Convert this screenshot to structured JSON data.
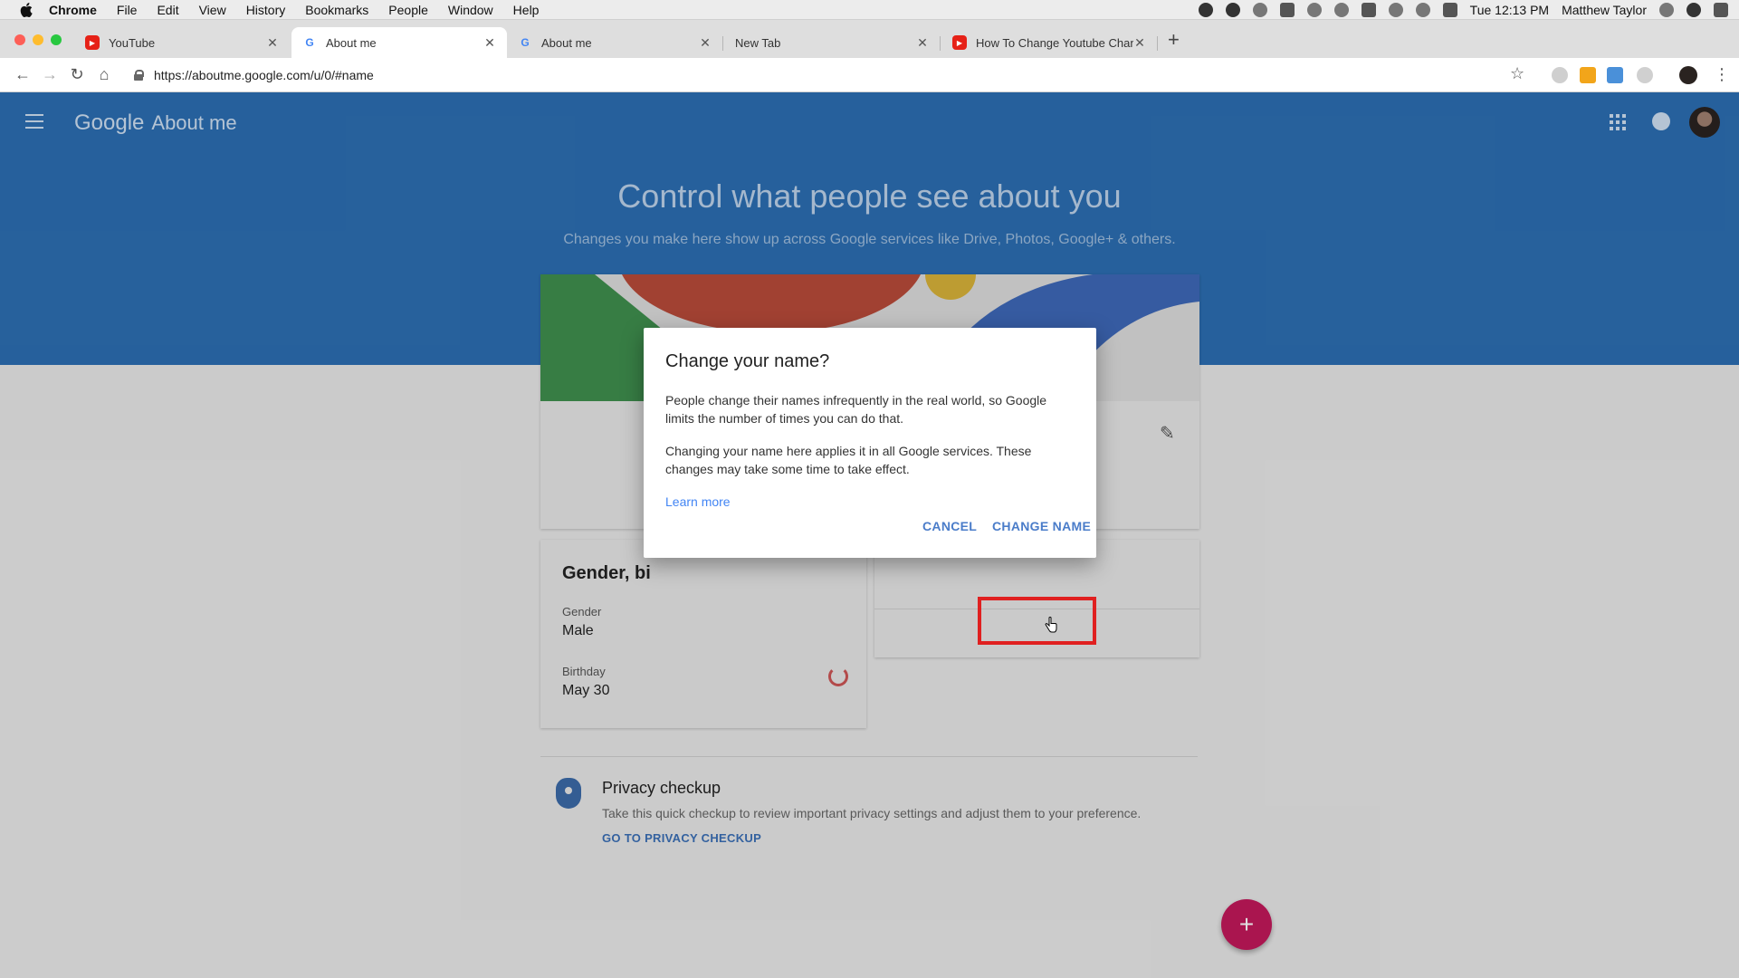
{
  "menubar": {
    "app": "Chrome",
    "items": [
      "File",
      "Edit",
      "View",
      "History",
      "Bookmarks",
      "People",
      "Window",
      "Help"
    ],
    "clock": "Tue 12:13 PM",
    "user": "Matthew Taylor"
  },
  "tabs": [
    {
      "title": "YouTube",
      "icon": "youtube-icon",
      "active": false
    },
    {
      "title": "About me",
      "icon": "google-icon",
      "active": true
    },
    {
      "title": "About me",
      "icon": "google-icon",
      "active": false
    },
    {
      "title": "New Tab",
      "icon": "",
      "active": false
    },
    {
      "title": "How To Change Youtube Chan",
      "icon": "youtube-icon",
      "active": false
    }
  ],
  "toolbar": {
    "url": "https://aboutme.google.com/u/0/#name"
  },
  "page": {
    "brand_google": "Google",
    "brand_product": "About me",
    "hero_title": "Control what people see about you",
    "hero_subtitle": "Changes you make here show up across Google services like Drive, Photos, Google+ & others."
  },
  "gender_card": {
    "heading": "Gender, bi",
    "gender_label": "Gender",
    "gender_value": "Male",
    "birthday_label": "Birthday",
    "birthday_value": "May 30"
  },
  "privacy": {
    "title": "Privacy checkup",
    "description": "Take this quick checkup to review important privacy settings and adjust them to your preference.",
    "link": "GO TO PRIVACY CHECKUP"
  },
  "fab": {
    "label": "+"
  },
  "dialog": {
    "title": "Change your name?",
    "body1": "People change their names infrequently in the real world, so Google limits the number of times you can do that.",
    "body2": "Changing your name here applies it in all Google services. These changes may take some time to take effect.",
    "learn_more": "Learn more",
    "cancel": "CANCEL",
    "confirm": "CHANGE NAME"
  },
  "colors": {
    "header_blue": "#2c6eb2",
    "accent_link": "#4285f4",
    "fab": "#c2185b",
    "highlight": "#e02020"
  }
}
